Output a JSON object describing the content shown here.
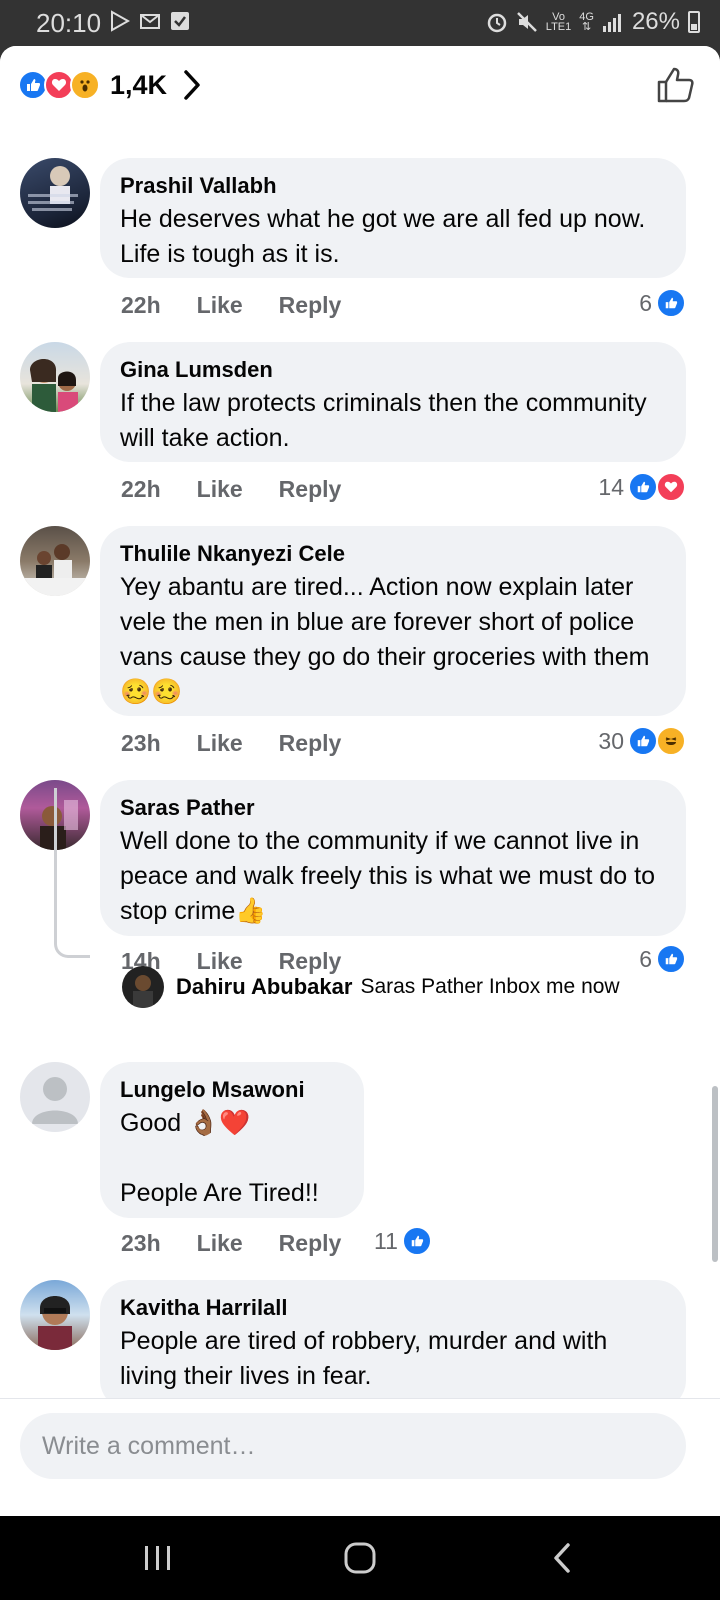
{
  "status_bar": {
    "time": "20:10",
    "network_top": "Vo",
    "network_bottom": "LTE1",
    "signal_type": "4G",
    "battery": "26%"
  },
  "reactions_bar": {
    "count": "1,4K",
    "reaction_icons": [
      "like-icon",
      "love-icon",
      "wow-icon"
    ]
  },
  "comments": [
    {
      "author": "Prashil Vallabh",
      "text": "He deserves what he got we are all fed up now. Life is tough as it is.",
      "time": "22h",
      "like_label": "Like",
      "reply_label": "Reply",
      "reaction_count": "6",
      "reactions": [
        "like"
      ]
    },
    {
      "author": "Gina Lumsden",
      "text": "If the law protects criminals then the community will take action.",
      "time": "22h",
      "like_label": "Like",
      "reply_label": "Reply",
      "reaction_count": "14",
      "reactions": [
        "like",
        "love"
      ]
    },
    {
      "author": "Thulile Nkanyezi Cele",
      "text": "Yey abantu are tired... Action now explain later vele the men in blue are forever short of police vans cause they go do their groceries with them 🥴🥴",
      "time": "23h",
      "like_label": "Like",
      "reply_label": "Reply",
      "reaction_count": "30",
      "reactions": [
        "like",
        "haha"
      ]
    },
    {
      "author": "Saras Pather",
      "text": "Well done to the community if we cannot live in peace and walk freely this is what we must do to stop crime👍",
      "time": "14h",
      "like_label": "Like",
      "reply_label": "Reply",
      "reaction_count": "6",
      "reactions": [
        "like"
      ]
    },
    {
      "author": "Lungelo Msawoni",
      "text": "Good 👌🏾❤️\n\nPeople Are Tired!!",
      "time": "23h",
      "like_label": "Like",
      "reply_label": "Reply",
      "reaction_count": "11",
      "reactions": [
        "like"
      ]
    },
    {
      "author": "Kavitha Harrilall",
      "text": "People are tired of robbery, murder and with living their lives in fear."
    }
  ],
  "reply": {
    "author": "Dahiru Abubakar",
    "text": "Saras Pather Inbox me now"
  },
  "composer": {
    "placeholder": "Write a comment…"
  },
  "colors": {
    "facebook_blue": "#1877f2",
    "love_red": "#f33e58",
    "bubble_gray": "#f0f2f5",
    "meta_gray": "#65676b"
  }
}
